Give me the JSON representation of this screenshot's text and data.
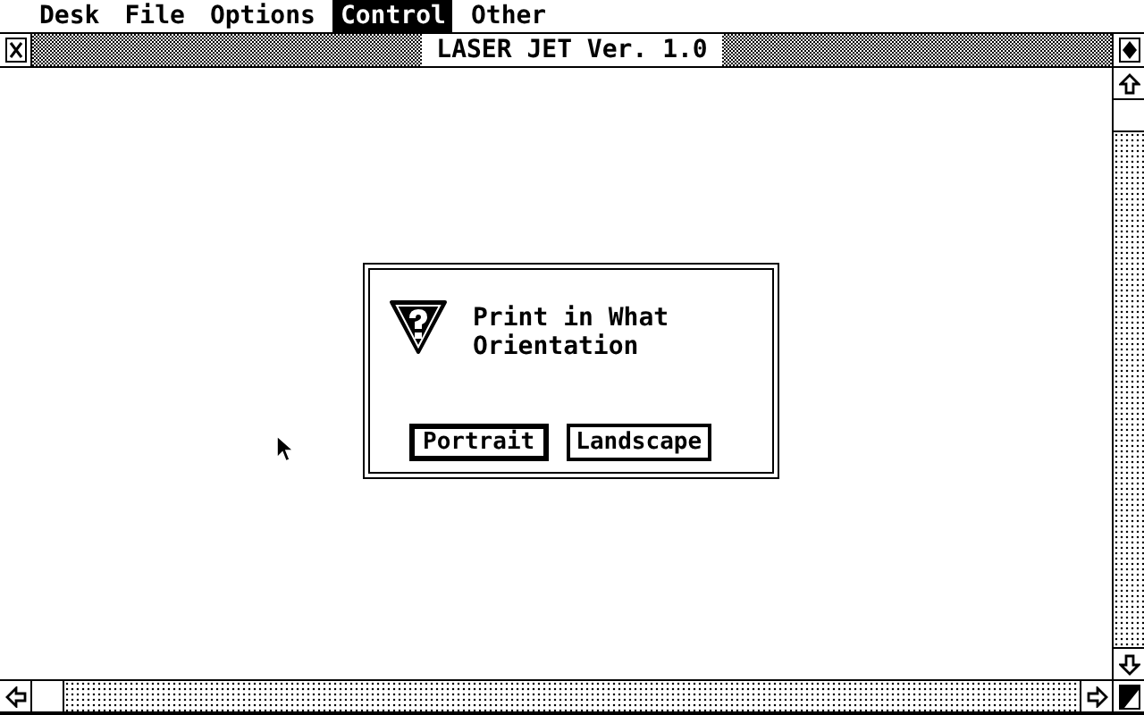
{
  "menu_bar": [
    {
      "label": "Desk",
      "selected": false
    },
    {
      "label": "File",
      "selected": false
    },
    {
      "label": "Options",
      "selected": false
    },
    {
      "label": "Control",
      "selected": true
    },
    {
      "label": "Other",
      "selected": false
    }
  ],
  "window": {
    "title": "LASER JET Ver. 1.0"
  },
  "dialog": {
    "message": [
      "Print in What",
      "Orientation"
    ],
    "buttons": [
      {
        "label": "Portrait",
        "default": true
      },
      {
        "label": "Landscape",
        "default": false
      }
    ]
  }
}
